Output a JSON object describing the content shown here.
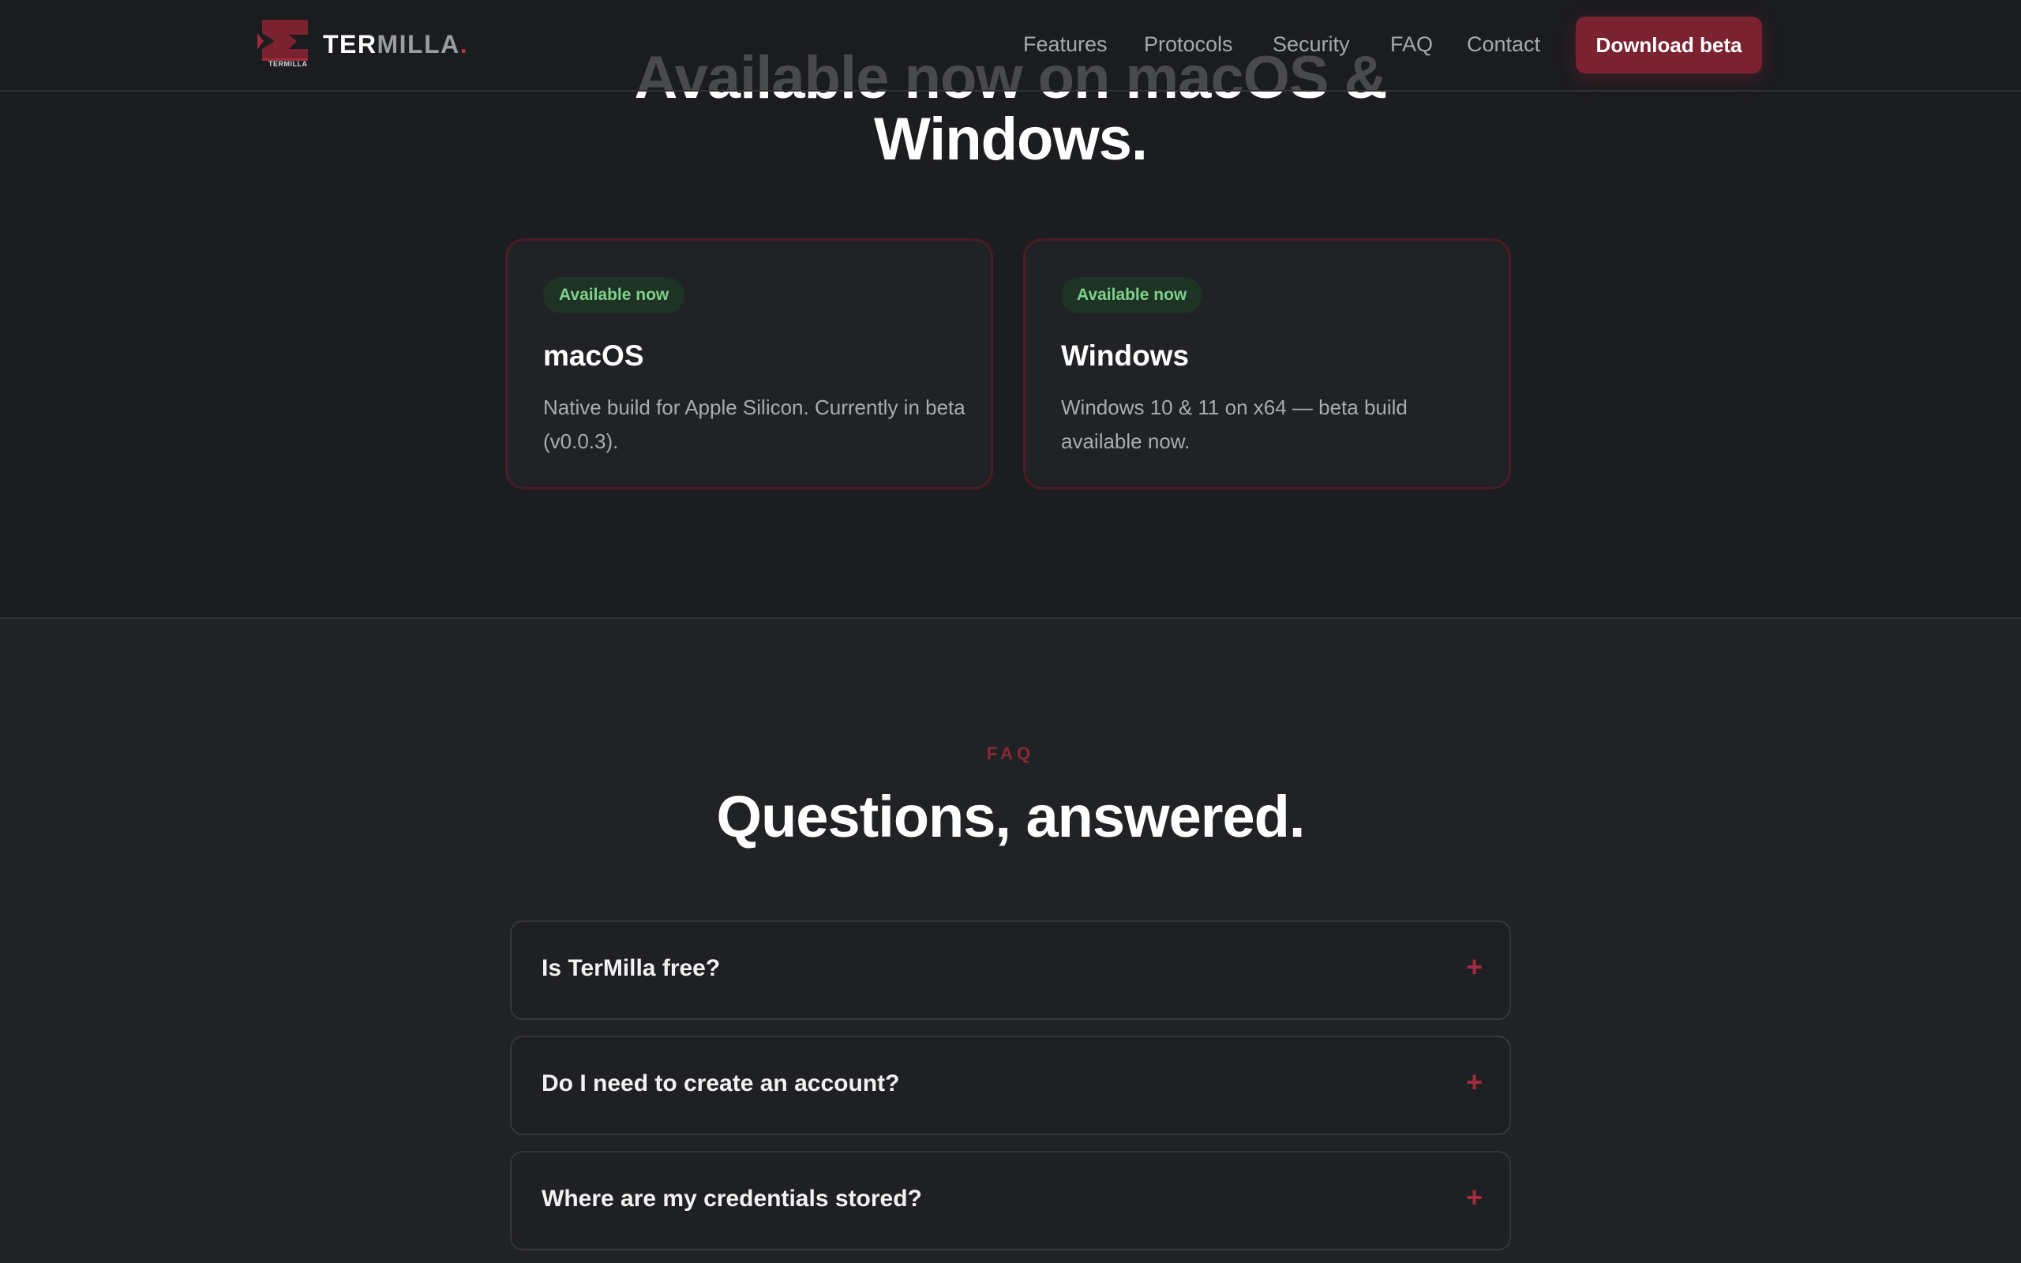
{
  "nav": {
    "brand_part1": "TER",
    "brand_part2": "MILLA",
    "brand_dot": ".",
    "logo_caption": "TERMILLA",
    "links": [
      "Features",
      "Protocols",
      "Security",
      "FAQ",
      "Contact"
    ],
    "cta_label": "Download beta"
  },
  "download": {
    "title_line1": "Available now on macOS &",
    "title_line2": "Windows.",
    "cards": [
      {
        "badge": "Available now",
        "title": "macOS",
        "description": "Native build for Apple Silicon. Currently in beta (v0.0.3)."
      },
      {
        "badge": "Available now",
        "title": "Windows",
        "description": "Windows 10 & 11 on x64 — beta build available now."
      }
    ]
  },
  "faq": {
    "eyebrow": "FAQ",
    "title": "Questions, answered.",
    "items": [
      {
        "question": "Is TerMilla free?",
        "toggle": "+"
      },
      {
        "question": "Do I need to create an account?",
        "toggle": "+"
      },
      {
        "question": "Where are my credentials stored?",
        "toggle": "+"
      }
    ]
  },
  "colors": {
    "accent": "#7a2230",
    "accent_text": "#a12c3b",
    "badge_bg": "#1e3324",
    "badge_text": "#7fd08c",
    "background": "#1b1c1f"
  }
}
